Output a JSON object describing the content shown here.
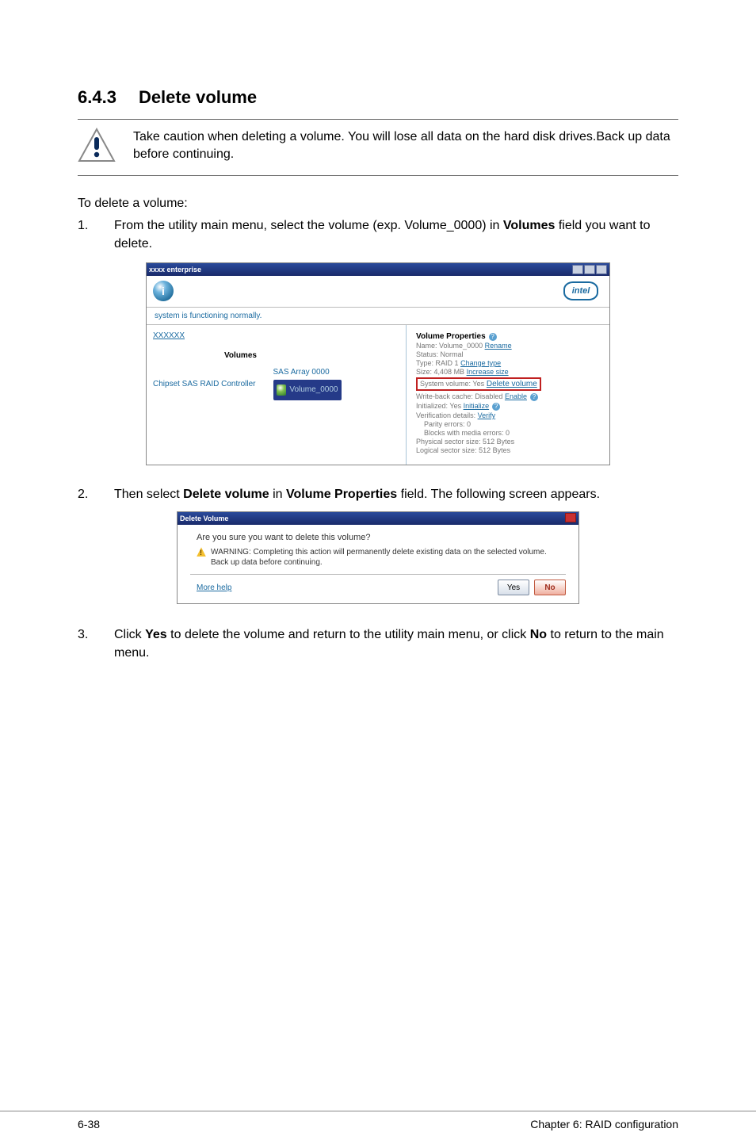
{
  "heading": {
    "number": "6.4.3",
    "title": "Delete volume"
  },
  "caution": "Take caution when deleting a volume. You will lose all data on the hard disk drives.Back up data before continuing.",
  "intro": "To delete a volume:",
  "steps": {
    "s1": {
      "num": "1.",
      "pre": "From the utility main menu, select the volume (exp. Volume_0000) in ",
      "bold": "Volumes",
      "post": " field you want to delete."
    },
    "s2": {
      "num": "2.",
      "pre": "Then select ",
      "bold1": "Delete volume",
      "mid": " in ",
      "bold2": "Volume Properties",
      "post": " field. The following screen appears."
    },
    "s3": {
      "num": "3.",
      "pre": "Click ",
      "bold1": "Yes",
      "mid": " to delete the volume and return to the utility main menu, or click ",
      "bold2": "No",
      "post": " to return to the main menu."
    }
  },
  "ss1": {
    "titlebar": "xxxx enterprise",
    "intel": "intel",
    "status": "system is functioning normally.",
    "left": {
      "link": "XXXXXX",
      "volumes_label": "Volumes",
      "controller": "Chipset SAS RAID Controller",
      "array": "SAS Array 0000",
      "selected": "Volume_0000"
    },
    "right": {
      "title": "Volume Properties",
      "name_label": "Name: Volume_0000",
      "rename": "Rename",
      "status": "Status: Normal",
      "type": "Type: RAID 1",
      "change_type": "Change type",
      "size": "Size: 4,408 MB",
      "increase": "Increase size",
      "sysvol": "System volume: Yes",
      "delete": "Delete volume",
      "writeback": "Write-back cache: Disabled",
      "enable": "Enable",
      "initialized": "Initialized: Yes",
      "initialize": "Initialize",
      "verification": "Verification details:",
      "verify": "Verify",
      "parity": "Parity errors: 0",
      "blocks": "Blocks with media errors: 0",
      "phys": "Physical sector size: 512 Bytes",
      "logical": "Logical sector size: 512 Bytes"
    }
  },
  "ss2": {
    "titlebar": "Delete Volume",
    "question": "Are you sure you want to delete this volume?",
    "warning": "WARNING: Completing this action will permanently delete existing data on the selected volume. Back up data before continuing.",
    "more": "More help",
    "yes": "Yes",
    "no": "No"
  },
  "footer": {
    "left": "6-38",
    "right": "Chapter 6: RAID configuration"
  }
}
